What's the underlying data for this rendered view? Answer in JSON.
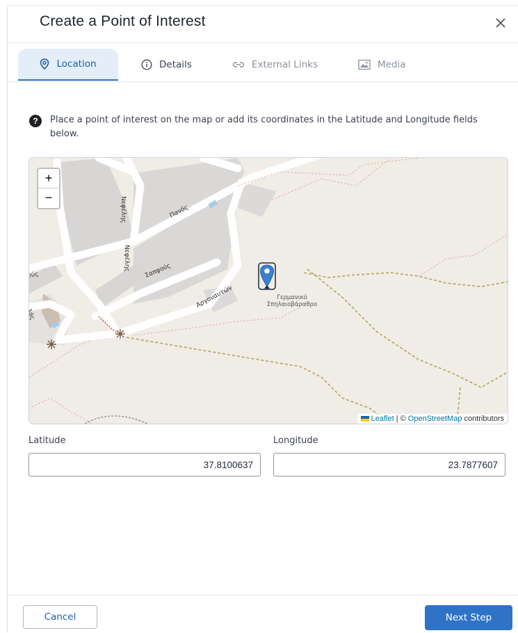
{
  "dialog": {
    "title": "Create a Point of Interest"
  },
  "tabs": [
    {
      "label": "Location",
      "icon": "map-pin-icon",
      "active": true
    },
    {
      "label": "Details",
      "icon": "info-icon",
      "active": false
    },
    {
      "label": "External Links",
      "icon": "link-icon",
      "active": false
    },
    {
      "label": "Media",
      "icon": "image-icon",
      "active": false
    }
  ],
  "help": {
    "text": "Place a point of interest on the map or add its coordinates in the Latitude and Longitude fields below."
  },
  "map": {
    "zoom_in": "+",
    "zoom_out": "−",
    "poi_label_line1": "Γερμανικό",
    "poi_label_line2": "Σπηλαιοβάραθρο",
    "street_labels": [
      "Νεφέλης",
      "Νεφέλης",
      "Πανός",
      "Σαπφούς",
      "Αργοναυτών",
      "ούς",
      "λάς"
    ],
    "attribution": {
      "leaflet": "Leaflet",
      "sep": "| ©",
      "osm": "OpenStreetMap",
      "contributors": "contributors"
    }
  },
  "fields": {
    "latitude": {
      "label": "Latitude",
      "value": "37.8100637"
    },
    "longitude": {
      "label": "Longitude",
      "value": "23.7877607"
    }
  },
  "footer": {
    "cancel": "Cancel",
    "next": "Next Step"
  },
  "colors": {
    "accent": "#2f73c7",
    "active_tab_bg": "#e3eef8",
    "marker": "#3b7fd0"
  }
}
